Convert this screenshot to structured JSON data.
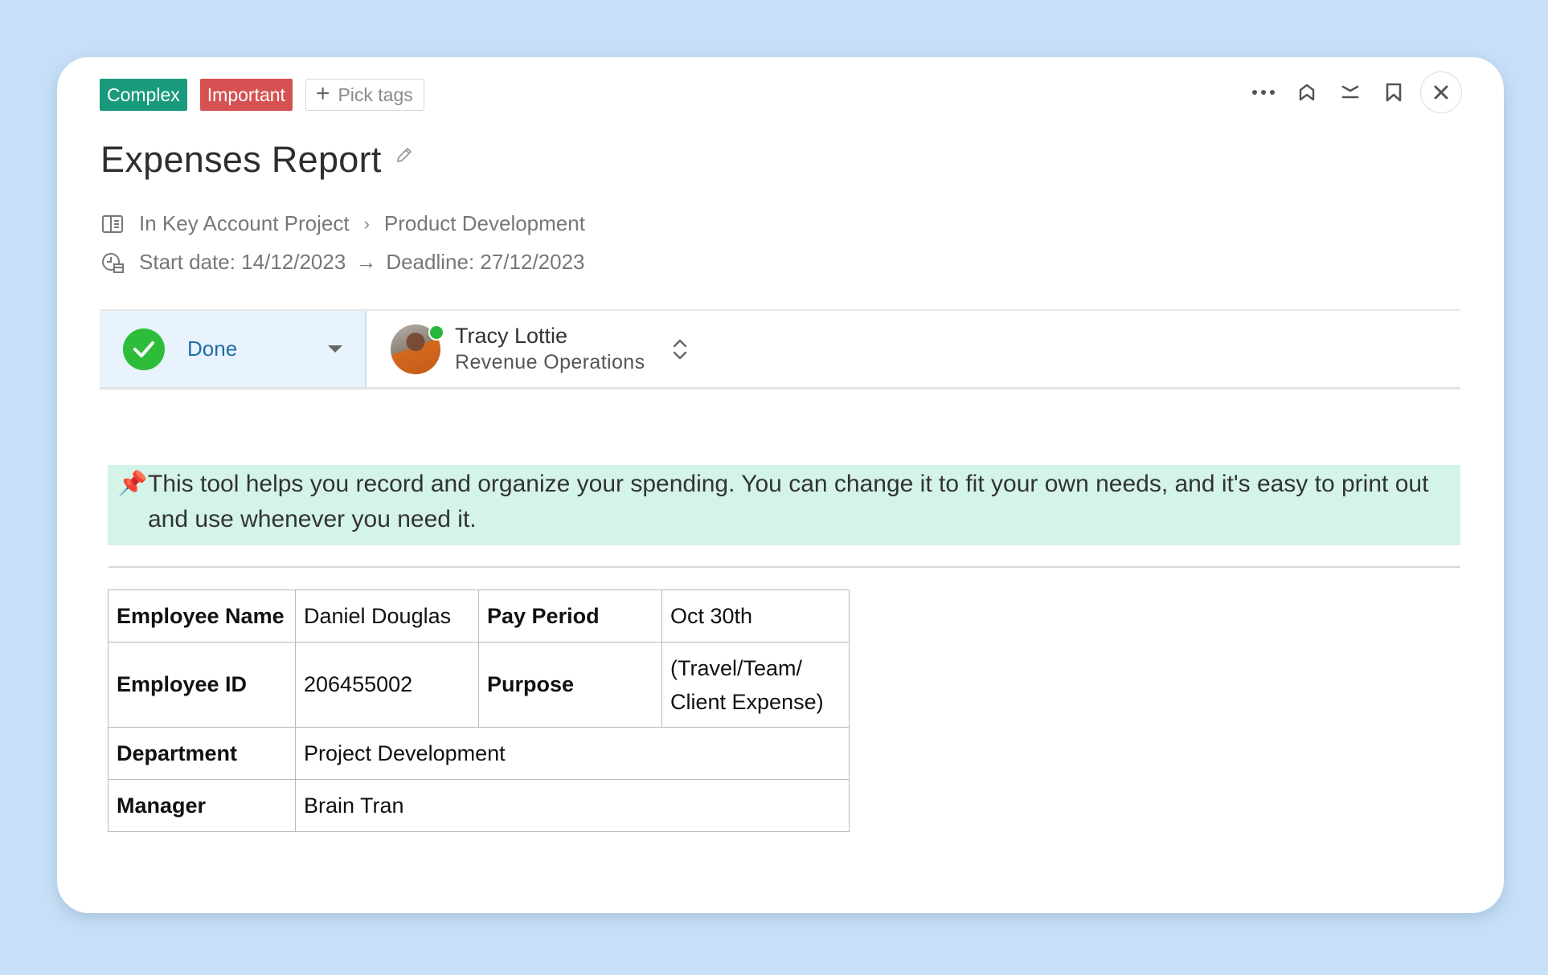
{
  "tags": {
    "items": [
      {
        "label": "Complex",
        "color": "#1a9a7d"
      },
      {
        "label": "Important",
        "color": "#d65252"
      }
    ],
    "pick_label": "Pick tags"
  },
  "header": {
    "icons": [
      "more-horizontal-icon",
      "pin-icon",
      "collapse-icon",
      "bookmark-icon",
      "close-icon"
    ]
  },
  "task": {
    "title": "Expenses Report",
    "project_prefix": "In Key Account Project",
    "project_section": "Product Development",
    "start_date": "Start date: 14/12/2023",
    "deadline": "Deadline: 27/12/2023"
  },
  "status": {
    "label": "Done",
    "color": "#2ebd3b"
  },
  "assignee": {
    "name": "Tracy Lottie",
    "team": "Revenue Operations"
  },
  "callout": {
    "icon": "📌",
    "text": "This tool helps you record and organize your spending. You can change it to fit your own needs, and it's easy to print out and use whenever you need it."
  },
  "table": {
    "employee_name_label": "Employee Name",
    "employee_name": "Daniel Douglas",
    "pay_period_label": "Pay Period",
    "pay_period": "Oct 30th",
    "employee_id_label": "Employee ID",
    "employee_id": "206455002",
    "purpose_label": "Purpose",
    "purpose_line1": "(Travel/Team/",
    "purpose_line2": "Client Expense)",
    "department_label": "Department",
    "department": "Project Development",
    "manager_label": "Manager",
    "manager": "Brain Tran"
  }
}
